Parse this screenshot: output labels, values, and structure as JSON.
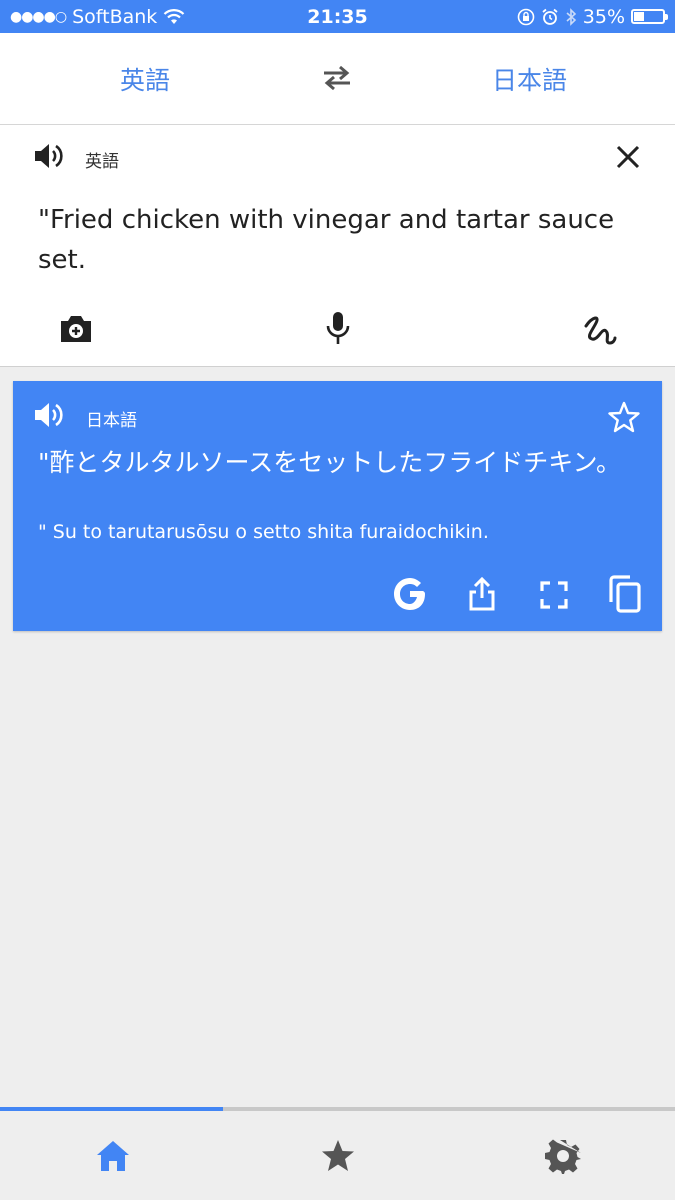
{
  "status_bar": {
    "carrier": "SoftBank",
    "time": "21:35",
    "battery_percent": "35%",
    "battery_level": 0.35
  },
  "language_bar": {
    "source_lang": "英語",
    "target_lang": "日本語",
    "swap_icon": "swap-arrows-icon"
  },
  "input": {
    "lang_label": "英語",
    "text": "\"Fried chicken with vinegar and tartar sauce set.",
    "tools": [
      "camera-icon",
      "mic-icon",
      "handwriting-icon"
    ]
  },
  "result": {
    "lang_label": "日本語",
    "text": "\"酢とタルタルソースをセットしたフライドチキン。",
    "romanization": "\" Su to tarutarusōsu o setto shita furaidochikin.",
    "actions": [
      "google-icon",
      "share-icon",
      "fullscreen-icon",
      "copy-icon"
    ]
  },
  "bottom_nav": {
    "items": [
      "home-icon",
      "star-icon",
      "settings-icon"
    ],
    "active": "home",
    "progress": 0.33
  },
  "colors": {
    "accent": "#4285f4",
    "text_link": "#4a86e8",
    "background": "#eeeeee"
  }
}
